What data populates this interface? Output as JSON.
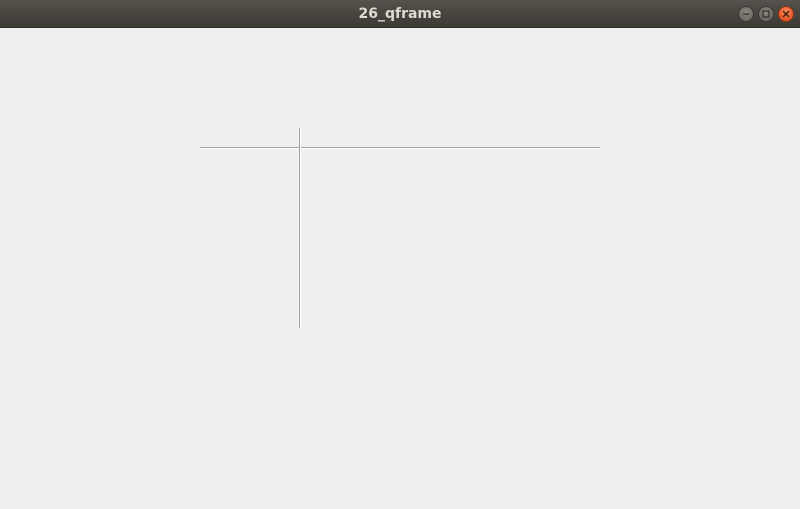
{
  "window": {
    "title": "26_qframe",
    "controls": {
      "minimize_icon": "minimize-icon",
      "maximize_icon": "maximize-icon",
      "close_icon": "close-icon"
    },
    "colors": {
      "titlebar": "#4a4743",
      "title_text": "#dfdbd2",
      "content_background": "#efefef",
      "close_button": "#e8592a",
      "frame_line": "#a0a0a0"
    }
  },
  "frames": [
    {
      "kind": "horizontal-line",
      "shape": "HLine",
      "shadow": "Sunken"
    },
    {
      "kind": "vertical-line",
      "shape": "VLine",
      "shadow": "Sunken"
    }
  ]
}
